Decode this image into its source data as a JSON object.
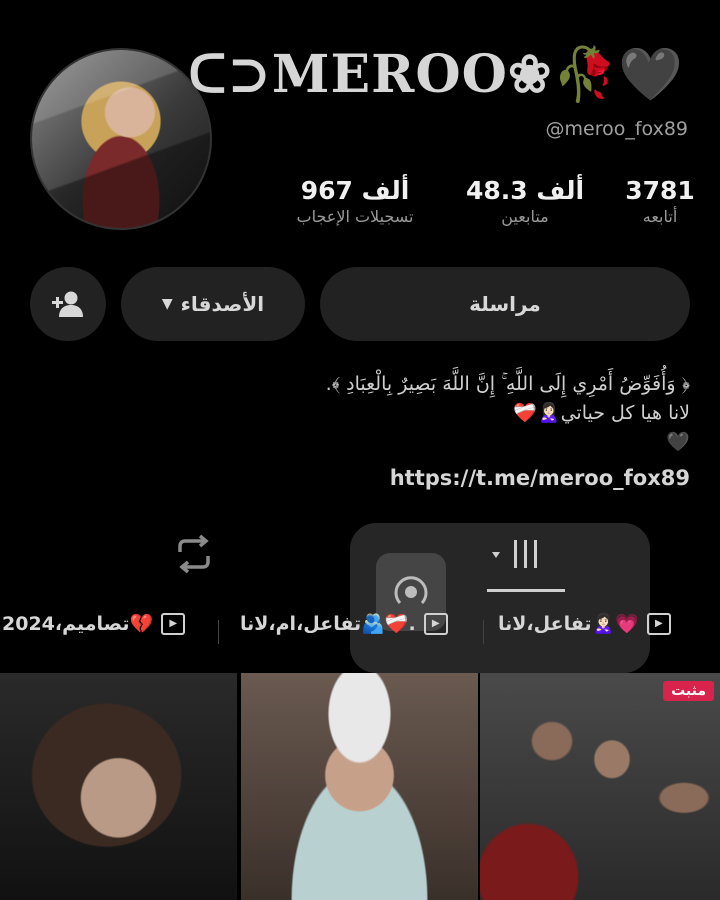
{
  "profile": {
    "display_name": "ᑕ⊃MEROO❀🥀🖤",
    "username": "@meroo_fox89",
    "stats": [
      {
        "value": "3781",
        "label": "أتابعه"
      },
      {
        "value": "48.3 ألف",
        "label": "متابعين"
      },
      {
        "value": "967 ألف",
        "label": "تسجيلات الإعجاب"
      }
    ]
  },
  "actions": {
    "message_label": "مراسلة",
    "friends_label": "الأصدقاء",
    "add_friend_icon": "add-user-icon"
  },
  "bio": {
    "line1": "﴿ وَأُفَوِّضُ أَمْرِي إِلَى اللَّهِ ۚ إِنَّ اللَّهَ بَصِيرٌ بِالْعِبَادِ ﴾.",
    "line2": "لانا هيا كل حياتي🙎🏻‍♀️❤️‍🩹",
    "line3": "🖤",
    "link": "https://t.me/meroo_fox89"
  },
  "playlists": [
    {
      "label": "تفاعل،لانا🙎🏻‍♀️💗"
    },
    {
      "label": "تفاعل،ام،لانا🫂❤️‍🩹."
    },
    {
      "label": "تصاميم،2024💔"
    }
  ],
  "videos": [
    {
      "pinned": ""
    },
    {
      "pinned": ""
    },
    {
      "pinned": "مثبت"
    }
  ],
  "colors": {
    "background": "#000000",
    "button": "#222222",
    "pinned": "#d8234c"
  }
}
